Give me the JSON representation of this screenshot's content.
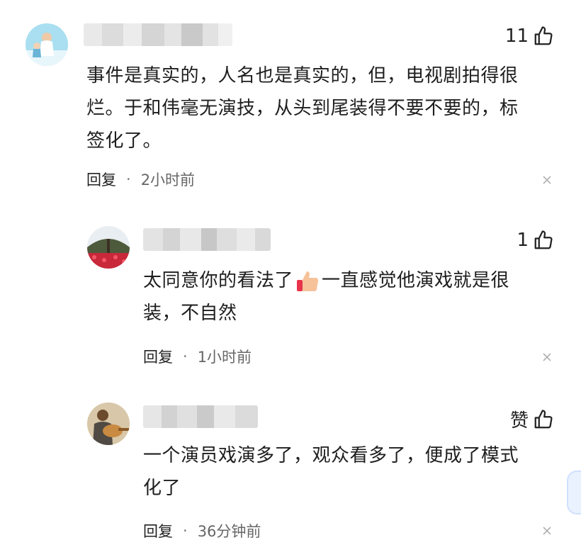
{
  "comments": [
    {
      "likes": "11",
      "text": [
        "事件是真实的，人名也是真实的，但，电视剧拍得很",
        "烂。于和伟毫无演技，从头到尾装得不要不要的，标",
        "签化了。"
      ],
      "reply_label": "回复",
      "separator": "·",
      "time": "2小时前"
    },
    {
      "likes": "1",
      "text_before_emoji": "太同意你的看法了",
      "text_after_emoji": "一直感觉他演戏就是很",
      "text_line2": "装，不自然",
      "emoji": "thumbs-up",
      "reply_label": "回复",
      "separator": "·",
      "time": "1小时前"
    },
    {
      "likes": "赞",
      "text": [
        "一个演员戏演多了，观众看多了，便成了模式",
        "化了"
      ],
      "reply_label": "回复",
      "separator": "·",
      "time": "36分钟前"
    }
  ],
  "icons": {
    "like": "thumbs-up-outline-icon",
    "close": "close-icon"
  }
}
